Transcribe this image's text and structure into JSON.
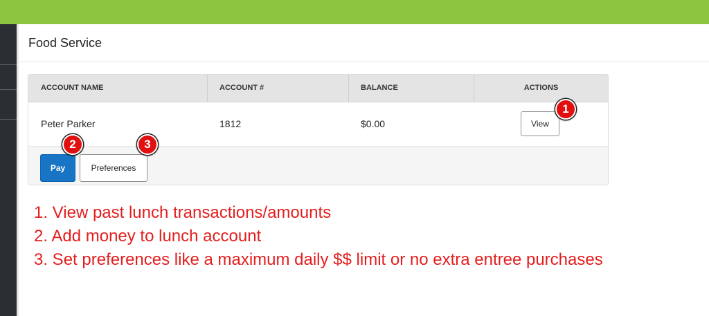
{
  "page": {
    "title": "Food Service"
  },
  "table": {
    "columns": [
      "ACCOUNT NAME",
      "ACCOUNT #",
      "BALANCE",
      "ACTIONS"
    ],
    "rows": [
      {
        "account_name": "Peter Parker",
        "account_number": "1812",
        "balance": "$0.00",
        "action_label": "View"
      }
    ]
  },
  "footer_actions": {
    "pay_label": "Pay",
    "preferences_label": "Preferences"
  },
  "markers": [
    "1",
    "2",
    "3"
  ],
  "notes": [
    "1. View past lunch transactions/amounts",
    "2. Add money to lunch account",
    "3. Set preferences like a maximum daily $$ limit or no extra entree purchases"
  ],
  "colors": {
    "top_bar": "#8cc63f",
    "sidebar": "#2b2f33",
    "pay_button": "#1874c4",
    "marker": "#e10f0f",
    "note_text": "#e41e1e"
  }
}
